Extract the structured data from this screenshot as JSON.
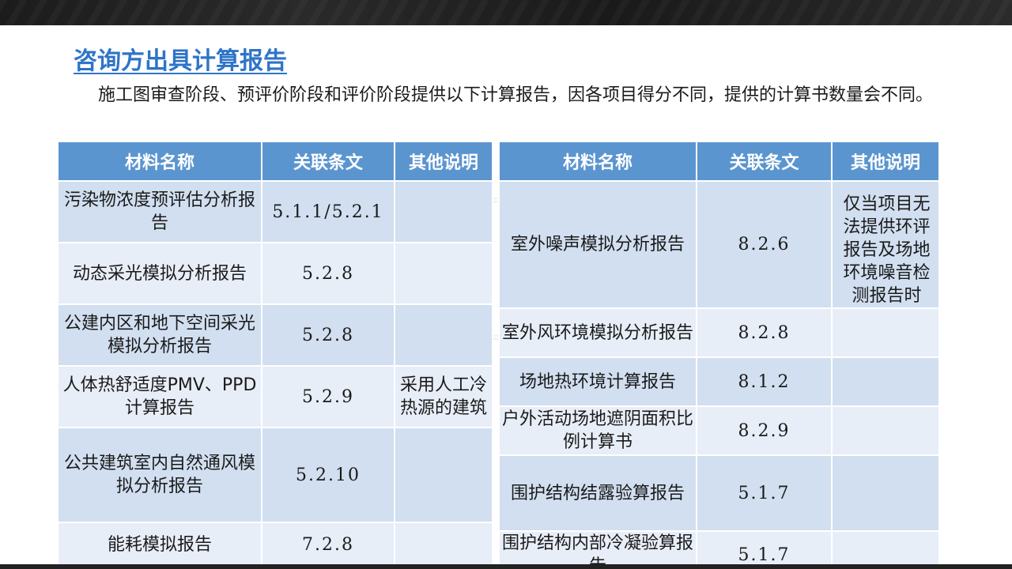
{
  "title": "咨询方出具计算报告",
  "intro": "施工图审查阶段、预评价阶段和评价阶段提供以下计算报告，因各项目得分不同，提供的计算书数量会不同。",
  "headers": {
    "name": "材料名称",
    "clause": "关联条文",
    "note": "其他说明"
  },
  "left_rows": [
    {
      "name": "污染物浓度预评估分析报告",
      "clause": "5.1.1/5.2.1",
      "note": ""
    },
    {
      "name": "动态采光模拟分析报告",
      "clause": "5.2.8",
      "note": ""
    },
    {
      "name": "公建内区和地下空间采光模拟分析报告",
      "clause": "5.2.8",
      "note": ""
    },
    {
      "name": "人体热舒适度PMV、PPD计算报告",
      "clause": "5.2.9",
      "note": "采用人工冷热源的建筑"
    },
    {
      "name": "公共建筑室内自然通风模拟分析报告",
      "clause": "5.2.10",
      "note": ""
    },
    {
      "name": "能耗模拟报告",
      "clause": "7.2.8",
      "note": ""
    }
  ],
  "right_rows": [
    {
      "name": "室外噪声模拟分析报告",
      "clause": "8.2.6",
      "note": "仅当项目无法提供环评报告及场地环境噪音检测报告时"
    },
    {
      "name": "室外风环境模拟分析报告",
      "clause": "8.2.8",
      "note": ""
    },
    {
      "name": "场地热环境计算报告",
      "clause": "8.1.2",
      "note": ""
    },
    {
      "name": "户外活动场地遮阴面积比例计算书",
      "clause": "8.2.9",
      "note": ""
    },
    {
      "name": "围护结构结露验算报告",
      "clause": "5.1.7",
      "note": ""
    },
    {
      "name": "围护结构内部冷凝验算报告",
      "clause": "5.1.7",
      "note": ""
    }
  ]
}
